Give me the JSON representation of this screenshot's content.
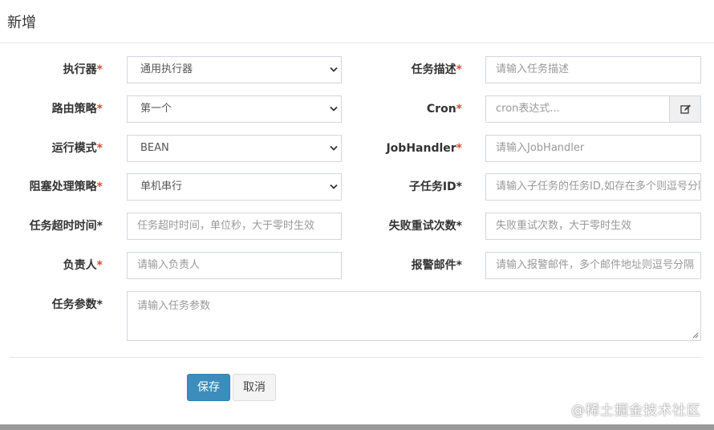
{
  "dialog": {
    "title": "新增"
  },
  "form": {
    "executor": {
      "label": "执行器",
      "value": "通用执行器"
    },
    "job_desc": {
      "label": "任务描述",
      "placeholder": "请输入任务描述"
    },
    "route_strategy": {
      "label": "路由策略",
      "value": "第一个"
    },
    "cron": {
      "label": "Cron",
      "placeholder": "cron表达式...",
      "addon_icon": "edit-icon"
    },
    "run_mode": {
      "label": "运行模式",
      "value": "BEAN"
    },
    "job_handler": {
      "label": "JobHandler",
      "placeholder": "请输入JobHandler"
    },
    "block_strategy": {
      "label": "阻塞处理策略",
      "value": "单机串行"
    },
    "child_job_id": {
      "label": "子任务ID",
      "placeholder": "请输入子任务的任务ID,如存在多个则逗号分隔"
    },
    "timeout": {
      "label": "任务超时时间",
      "placeholder": "任务超时时间，单位秒，大于零时生效"
    },
    "retry_count": {
      "label": "失败重试次数",
      "placeholder": "失败重试次数，大于零时生效"
    },
    "author": {
      "label": "负责人",
      "placeholder": "请输入负责人"
    },
    "alarm_email": {
      "label": "报警邮件",
      "placeholder": "请输入报警邮件，多个邮件地址则逗号分隔"
    },
    "job_param": {
      "label": "任务参数",
      "placeholder": "请输入任务参数"
    },
    "required_mark": "*"
  },
  "actions": {
    "save_label": "保存",
    "cancel_label": "取消"
  },
  "watermark": "@稀土掘金技术社区",
  "colors": {
    "primary": "#3c8dbc",
    "required": "#dd4b39",
    "border": "#d2d6de"
  }
}
